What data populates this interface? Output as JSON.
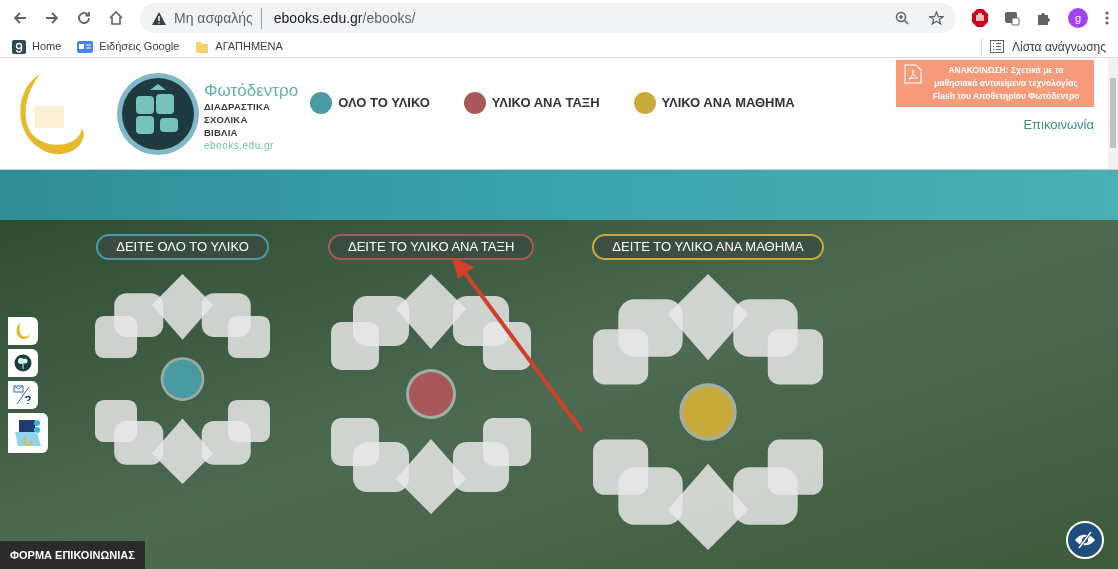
{
  "browser": {
    "security_label": "Μη ασφαλής",
    "url_host": "ebooks.edu.gr",
    "url_path": "/ebooks/",
    "profile_letter": "g",
    "bookmarks": [
      {
        "kind": "site",
        "label": "Home"
      },
      {
        "kind": "news",
        "label": "Ειδήσεις Google"
      },
      {
        "kind": "folder",
        "label": "ΑΓΑΠΗΜΕΝΑ"
      }
    ],
    "reading_list": "Λίστα ανάγνωσης"
  },
  "header": {
    "brand": {
      "title": "Φωτόδεντρο",
      "lines": [
        "ΔΙΑΔΡΑΣΤΙΚΑ",
        "ΣΧΟΛΙΚΑ",
        "ΒΙΒΛΙΑ"
      ],
      "domain": "ebooks.edu.gr"
    },
    "nav": [
      {
        "label": "ΟΛΟ ΤΟ ΥΛΙΚΟ",
        "color": "#4a9aa3"
      },
      {
        "label": "ΥΛΙΚΟ ΑΝΑ ΤΑΞΗ",
        "color": "#a85858"
      },
      {
        "label": "ΥΛΙΚΟ ΑΝΑ ΜΑΘΗΜΑ",
        "color": "#c9ab3c"
      }
    ],
    "announcement": "ΑΝΑΚΟΙΝΩΣΗ: Σχετικά με τα μαθησιακά αντικείμενα τεχνολογίας Flash του Αποθετηρίου Φωτόδεντρο",
    "contact_link": "Επικοινωνία"
  },
  "sections": [
    {
      "button": "ΔΕΙΤΕ ΟΛΟ ΤΟ ΥΛΙΚΟ",
      "color": "#4a9aa3"
    },
    {
      "button": "ΔΕΙΤΕ ΤΟ ΥΛΙΚΟ ΑΝΑ ΤΑΞΗ",
      "color": "#a85858"
    },
    {
      "button": "ΔΕΙΤΕ ΤΟ ΥΛΙΚΟ ΑΝΑ ΜΑΘΗΜΑ",
      "color": "#c9ab3c"
    }
  ],
  "contact_form_button": "ΦΟΡΜΑ ΕΠΙΚΟΙΝΩΝΙΑΣ"
}
